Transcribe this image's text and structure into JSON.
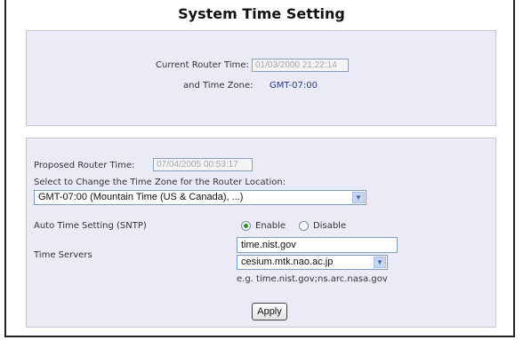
{
  "page": {
    "title": "System Time Setting"
  },
  "current": {
    "router_time_label": "Current Router Time:",
    "router_time_value": "01/03/2000 21:22:14",
    "time_zone_label": "and Time Zone:",
    "time_zone_value": "GMT-07:00"
  },
  "settings": {
    "proposed_time_label": "Proposed Router Time:",
    "proposed_time_value": "07/04/2005 00:53:17",
    "zone_select_label": "Select to Change the Time Zone for the Router Location:",
    "zone_select_value": "GMT-07:00 (Mountain Time (US & Canada), ...)",
    "sntp_label": "Auto Time Setting (SNTP)",
    "enable_label": "Enable",
    "disable_label": "Disable",
    "sntp_state": "Enable",
    "time_servers_label": "Time Servers",
    "time_server_input": "time.nist.gov",
    "time_server_select": "cesium.mtk.nao.ac.jp",
    "example_text": "e.g. time.nist.gov;ns.arc.nasa.gov",
    "apply_label": "Apply"
  },
  "icons": {
    "dropdown": "chevron-down-icon",
    "radio_on": "radio-checked-icon",
    "radio_off": "radio-unchecked-icon"
  },
  "colors": {
    "panel_bg": "#ebebf8",
    "time_zone_text": "#2b3b8c",
    "radio_dot": "#2a8a2a"
  }
}
